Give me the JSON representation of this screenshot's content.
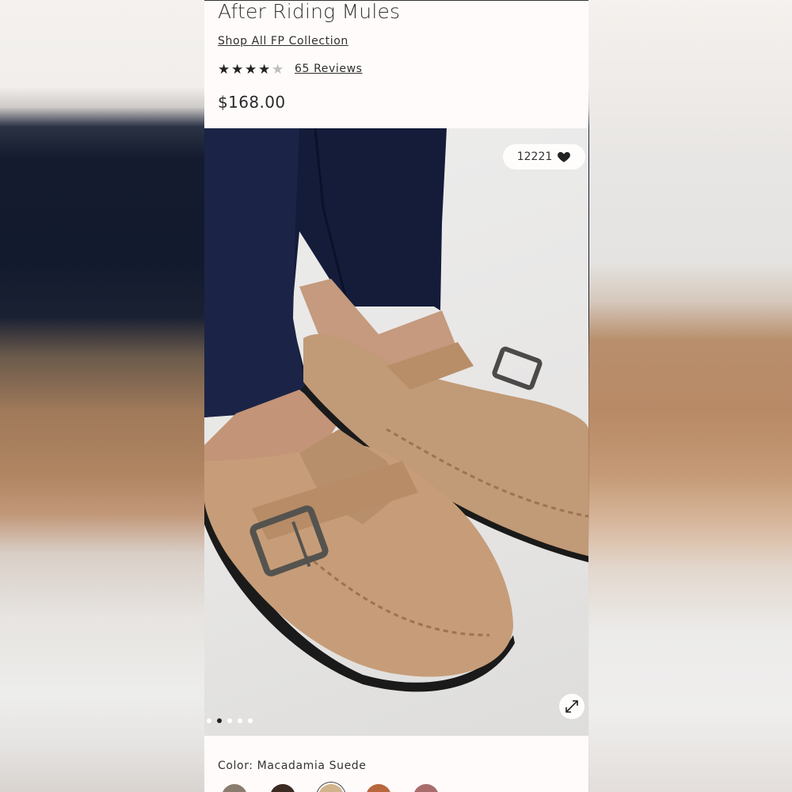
{
  "product": {
    "title": "After Riding Mules",
    "collection_link": "Shop All FP Collection",
    "rating": 4,
    "rating_max": 5,
    "reviews_label": "65 Reviews",
    "price": "$168.00"
  },
  "gallery": {
    "like_count": "12221",
    "like_icon": "heart-icon",
    "expand_icon": "expand-icon",
    "slide_count": 5,
    "active_slide": 2
  },
  "color": {
    "label": "Color: Macadamia Suede",
    "swatches": [
      "#8a7d70",
      "#3b2a22",
      "#d2b48c",
      "#b8683c",
      "#a86c6c"
    ],
    "selected_index": 2
  }
}
